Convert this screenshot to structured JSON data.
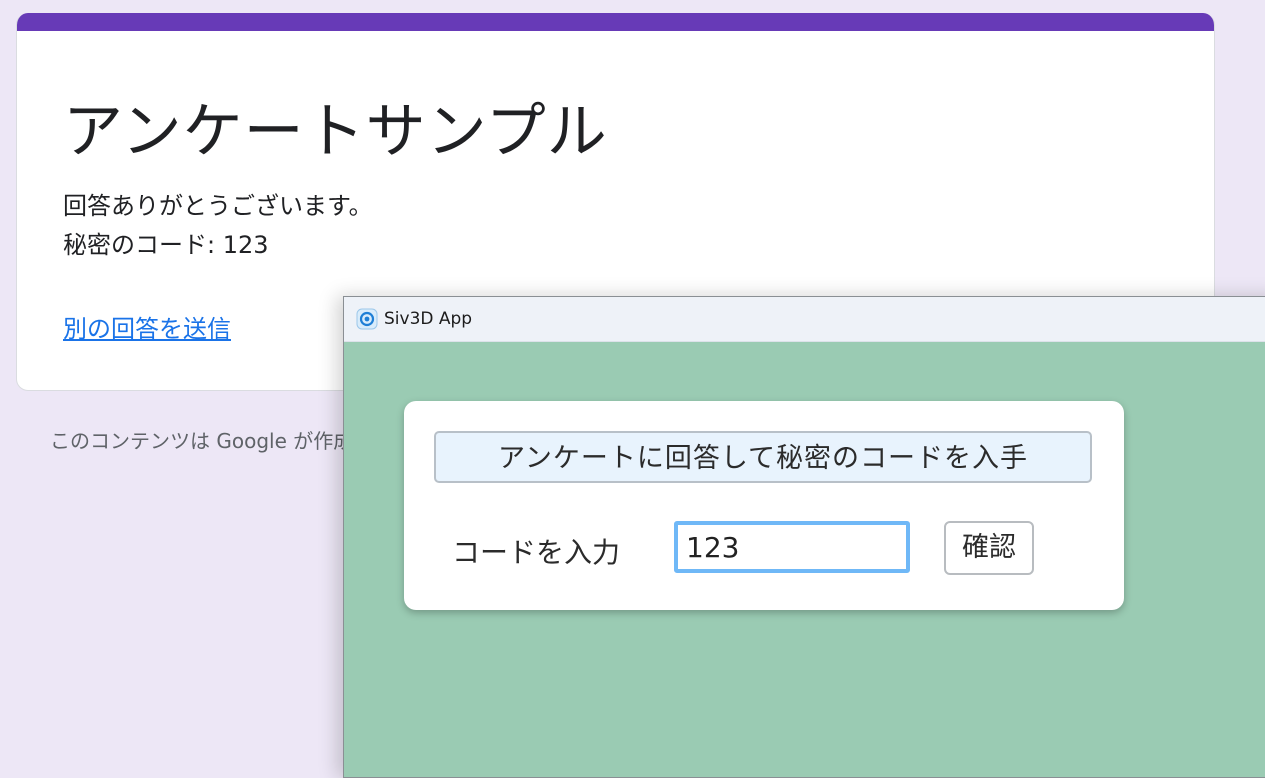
{
  "form": {
    "title": "アンケートサンプル",
    "message_line1": "回答ありがとうございます。",
    "message_line2": "秘密のコード: 123",
    "link": "別の回答を送信",
    "footer": "このコンテンツは Google が作成または承認したものではありません。"
  },
  "app": {
    "window_title": "Siv3D App",
    "icon": "siv3d-icon",
    "survey_button": "アンケートに回答して秘密のコードを入手",
    "code_label": "コードを入力",
    "code_value": "123",
    "confirm_button": "確認"
  },
  "colors": {
    "form_accent": "#673ab7",
    "page_bg": "#ede7f6",
    "app_bg": "#9acbb3",
    "link": "#1a73e8",
    "input_focus": "#6fb8f7"
  }
}
